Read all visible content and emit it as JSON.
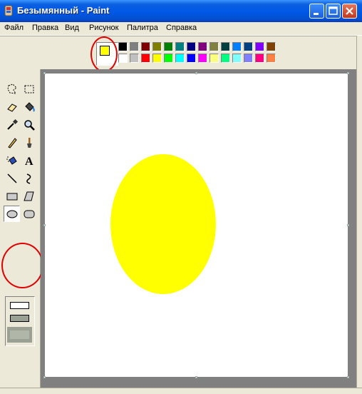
{
  "window": {
    "title": "Безымянный - Paint",
    "icon": "paint-app-icon",
    "controls": [
      "minimize-icon",
      "maximize-icon",
      "close-icon"
    ]
  },
  "menu": {
    "items": [
      "Файл",
      "Правка",
      "Вид",
      "Рисунок",
      "Палитра",
      "Справка"
    ]
  },
  "colors": {
    "foreground": "#ffff00",
    "background": "#ffffff",
    "palette_top": [
      "#000000",
      "#808080",
      "#800000",
      "#808000",
      "#008000",
      "#008080",
      "#000080",
      "#800080",
      "#808040",
      "#004040",
      "#0080ff",
      "#004080",
      "#8000ff",
      "#804000"
    ],
    "palette_bottom": [
      "#ffffff",
      "#c0c0c0",
      "#ff0000",
      "#ffff00",
      "#00ff00",
      "#00ffff",
      "#0000ff",
      "#ff00ff",
      "#ffff80",
      "#00ff80",
      "#80ffff",
      "#8080ff",
      "#ff0080",
      "#ff8040"
    ],
    "annotation": "#e00000"
  },
  "tools": [
    "free-select",
    "select",
    "eraser",
    "fill",
    "pick-color",
    "magnifier",
    "pencil",
    "brush",
    "airbrush",
    "text",
    "line",
    "curve",
    "rectangle",
    "polygon",
    "ellipse",
    "rounded-rectangle"
  ],
  "selected_tool": "ellipse",
  "fill_style_options": [
    "outline-only",
    "outline-and-fill",
    "fill-only"
  ],
  "selected_fill_style": "fill-only",
  "canvas": {
    "background": "#ffffff",
    "shape": {
      "type": "ellipse",
      "fill": "#ffff00"
    }
  }
}
